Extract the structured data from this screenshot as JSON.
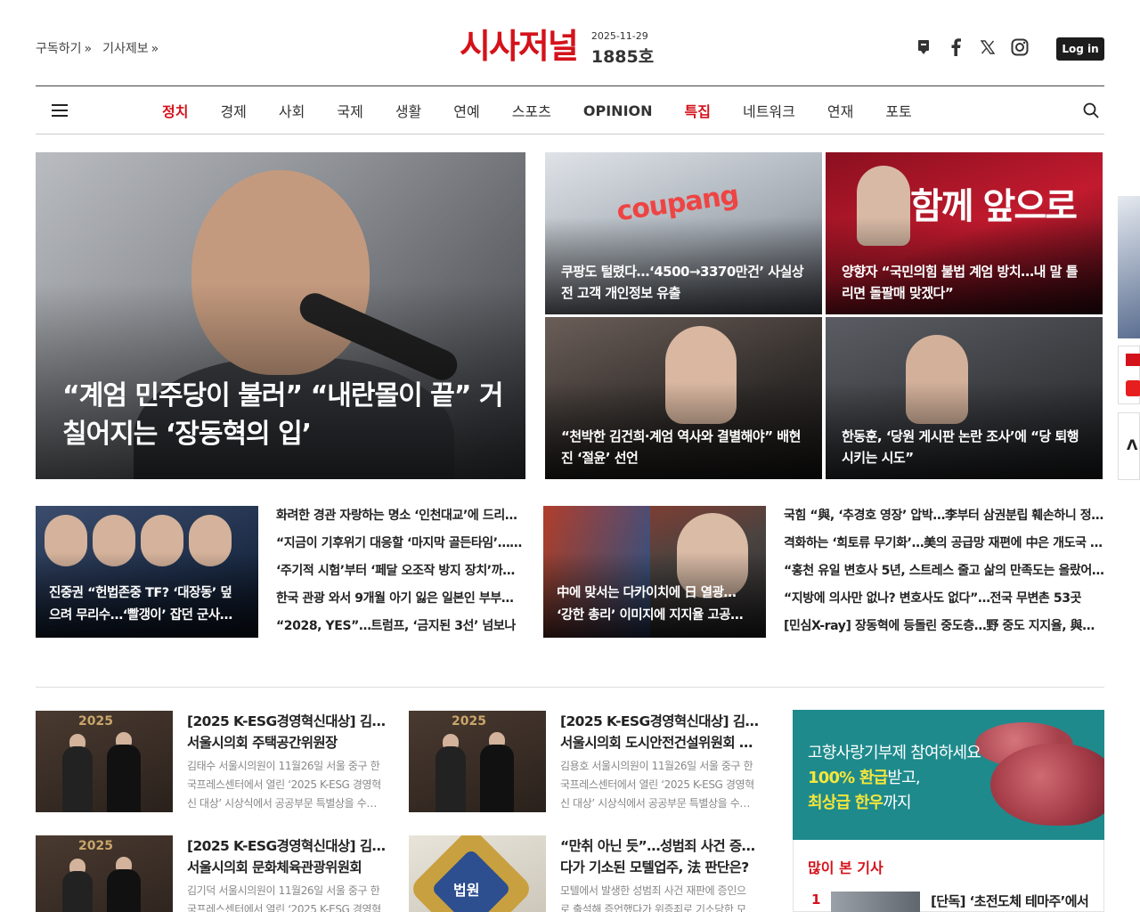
{
  "header": {
    "links": [
      "구독하기",
      "기사제보"
    ],
    "logo": "시사저널",
    "issue_date": "2025-11-29",
    "issue_no": "1885호",
    "login_label": "Log in",
    "social_icons": [
      "newsletter-icon",
      "facebook-icon",
      "x-icon",
      "instagram-icon"
    ]
  },
  "nav": {
    "items": [
      {
        "label": "정치",
        "highlight": true
      },
      {
        "label": "경제"
      },
      {
        "label": "사회"
      },
      {
        "label": "국제"
      },
      {
        "label": "생활"
      },
      {
        "label": "연예"
      },
      {
        "label": "스포츠"
      },
      {
        "label": "OPINION",
        "bold": true
      },
      {
        "label": "특집",
        "highlight": true
      },
      {
        "label": "네트워크"
      },
      {
        "label": "연재"
      },
      {
        "label": "포토"
      }
    ]
  },
  "hero": {
    "main": {
      "line1": "“계엄 민주당이 불러” “내란몰이 끝” 거",
      "line2": "칠어지는 ‘장동혁의 입’"
    },
    "tiles": [
      {
        "sign": "coupang",
        "line1": "쿠팡도 털렸다…‘4500→3370만건’ 사실상",
        "line2": "전 고객 개인정보 유출"
      },
      {
        "sign": "함께 앞으로",
        "line1": "양향자 “국민의힘 불법 계엄 방치…내 말 틀",
        "line2": "리면 돌팔매 맞겠다”"
      },
      {
        "line1": "“천박한 김건희·계엄 역사와 결별해야” 배현",
        "line2": "진 ‘절윤’ 선언"
      },
      {
        "line1": "한동훈, ‘당원 게시판 논란 조사’에 “당 퇴행",
        "line2": "시키는 시도”"
      }
    ]
  },
  "middle": {
    "left_thumb": {
      "line1": "진중권 “헌법존중 TF? ‘대장동’ 덮",
      "line2": "으려 무리수…‘빨갱이’ 잡던 군사…"
    },
    "left_list": [
      "화려한 경관 자랑하는 명소 ‘인천대교’에 드리…",
      "“지금이 기후위기 대응할 ‘마지막 골든타임’……",
      "‘주기적 시험’부터 ‘페달 오조작 방지 장치’까지…",
      "한국 관광 와서 9개월 아기 잃은 일본인 부부…",
      "“2028, YES”…트럼프, ‘금지된 3선’ 넘보나"
    ],
    "right_thumb": {
      "line1": "中에 맞서는 다카이치에 日 열광…",
      "line2": "‘강한 총리’ 이미지에 지지율 고공…"
    },
    "right_list": [
      "국힘 “與, ‘추경호 영장’ 압박…李부터 삼권분립 훼손하니 정…",
      "격화하는 ‘희토류 무기화’…美의 공급망 재편에 中은 개도국 …",
      "“홍천 유일 변호사 5년, 스트레스 줄고 삶의 만족도는 올랐어…",
      "“지방에 의사만 없나? 변호사도 없다”…전국 무변촌 53곳",
      "[민심X-ray] 장동혁에 등돌린 중도층…野 중도 지지율, 與에 ‘…"
    ]
  },
  "articles": [
    {
      "year": "2025",
      "title1": "[2025 K-ESG경영혁신대상] 김태수",
      "title2": "서울시의회 주택공간위원장",
      "sum1": "김태수 서울시의원이 11월26일 서울 중구 한",
      "sum2": "국프레스센터에서 열린 ‘2025 K-ESG 경영혁",
      "sum3": "신 대상’ 시상식에서 공공부문 특별상을 수…"
    },
    {
      "year": "2025",
      "title1": "[2025 K-ESG경영혁신대상] 김용호",
      "title2": "서울시의회 도시안전건설위원회 …",
      "sum1": "김용호 서울시의원이 11월26일 서울 중구 한",
      "sum2": "국프레스센터에서 열린 ‘2025 K-ESG 경영혁",
      "sum3": "신 대상’ 시상식에서 공공부문 특별상을 수…"
    },
    {
      "year": "2025",
      "title1": "[2025 K-ESG경영혁신대상] 김기덕",
      "title2": "서울시의회 문화체육관광위원회",
      "sum1": "김기덕 서울시의원이 11월26일 서울 중구 한",
      "sum2": "국프레스센터에서 열린 ‘2025 K-ESG 경영혁",
      "sum3": ""
    },
    {
      "badge": "법원",
      "title1": "“만취 아닌 듯”…성범죄 사건 증언했",
      "title2": "다가 기소된 모텔업주, 法 판단은?",
      "sum1": "모텔에서 발생한 성범죄 사건 재판에 증인으",
      "sum2": "로 출석해 증언했다가 위증죄로 기소당한 모",
      "sum3": ""
    }
  ],
  "ad": {
    "line1": "고향사랑기부제 참여하세요",
    "line2_em": "100% 환급",
    "line2_rest": "받고,",
    "line3_em": "최상급 한우",
    "line3_rest": "까지"
  },
  "popular": {
    "heading": "많이 본 기사",
    "rank": "1",
    "title": "[단독] ‘초전도체 테마주’에서"
  },
  "edge": {
    "glyph": "Λ"
  }
}
